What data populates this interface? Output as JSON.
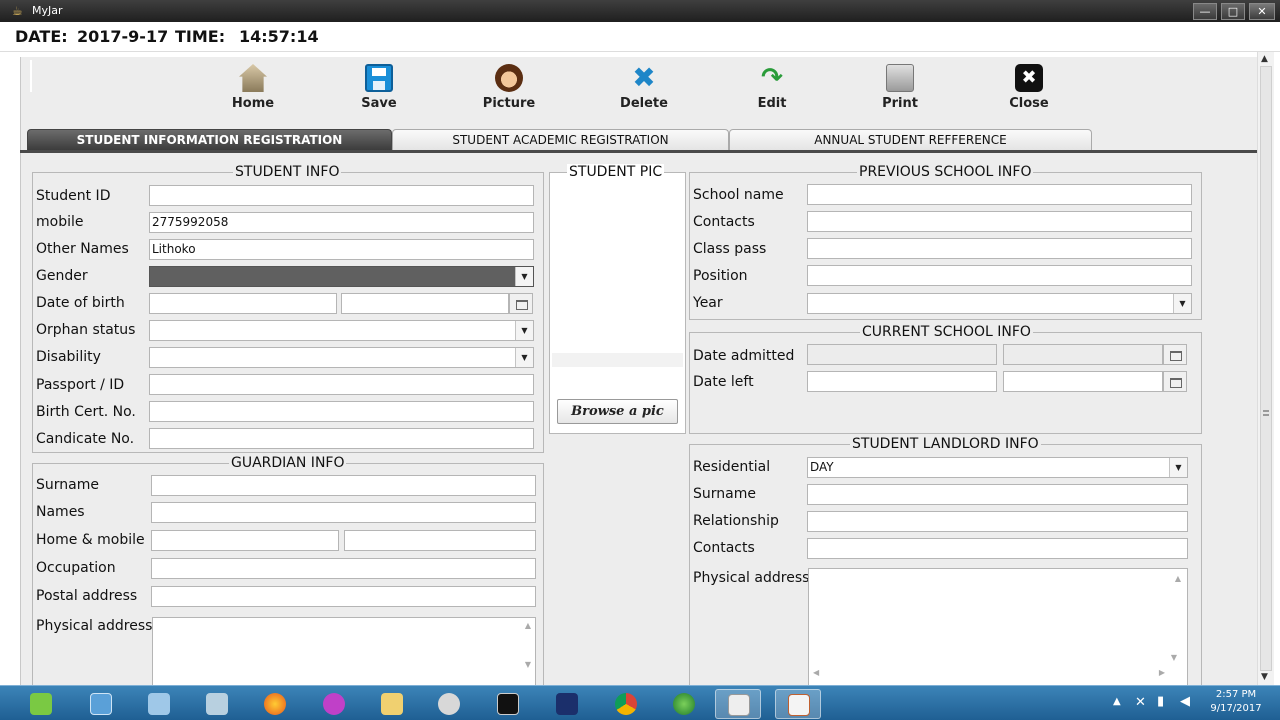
{
  "window": {
    "title": "MyJar",
    "minimize": "—",
    "maximize": "□",
    "close": "✕"
  },
  "status": {
    "date_label": "DATE:",
    "date_value": "2017-9-17",
    "time_label": "TIME:",
    "time_value": "14:57:14"
  },
  "toolbar": {
    "home": "Home",
    "save": "Save",
    "picture": "Picture",
    "delete": "Delete",
    "edit": "Edit",
    "print": "Print",
    "close": "Close"
  },
  "tabs": [
    "STUDENT INFORMATION REGISTRATION",
    "STUDENT ACADEMIC REGISTRATION",
    "ANNUAL STUDENT REFFERENCE"
  ],
  "student_info": {
    "title": "STUDENT INFO",
    "labels": [
      "Student ID",
      "mobile",
      "Other Names",
      "Gender",
      "Date of birth",
      "Orphan status",
      "Disability",
      "Passport / ID",
      "Birth Cert. No.",
      "Candicate No."
    ],
    "mobile_value": "2775992058",
    "other_names_value": "Lithoko"
  },
  "guardian_info": {
    "title": "GUARDIAN INFO",
    "labels": [
      "Surname",
      "Names",
      "Home & mobile",
      "Occupation",
      "Postal address",
      "Physical address"
    ]
  },
  "student_pic": {
    "title": "STUDENT PIC",
    "browse": "Browse a pic"
  },
  "previous_school": {
    "title": "PREVIOUS SCHOOL INFO",
    "labels": [
      "School name",
      "Contacts",
      "Class pass",
      "Position",
      "Year"
    ]
  },
  "current_school": {
    "title": "CURRENT SCHOOL INFO",
    "labels": [
      "Date admitted",
      "Date left"
    ]
  },
  "landlord": {
    "title": "STUDENT LANDLORD INFO",
    "labels": [
      "Residential",
      "Surname",
      "Relationship",
      "Contacts",
      "Physical address"
    ],
    "residential_value": "DAY"
  },
  "taskbar": {
    "clock_time": "2:57 PM",
    "clock_date": "9/17/2017"
  }
}
